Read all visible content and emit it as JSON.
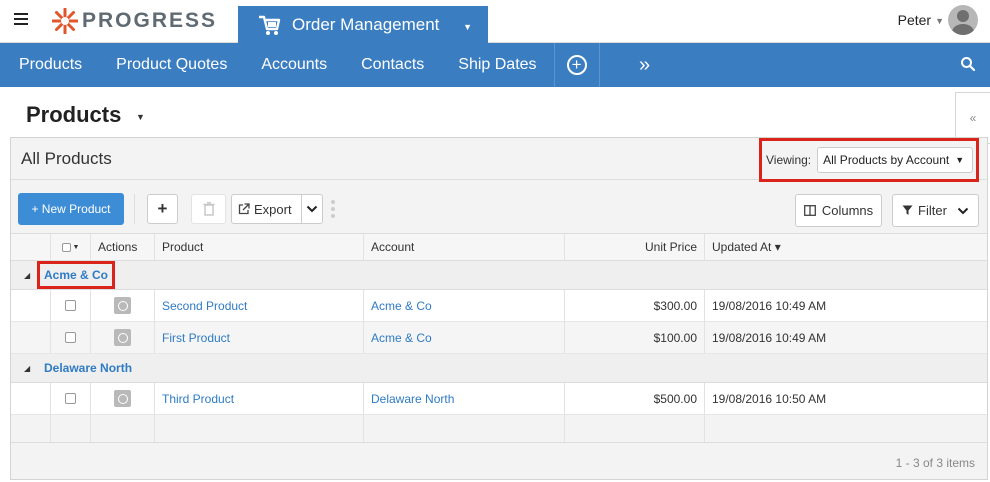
{
  "topbar": {
    "brand": "PROGRESS",
    "app_name": "Order Management",
    "user_name": "Peter"
  },
  "nav": {
    "items": [
      "Products",
      "Product Quotes",
      "Accounts",
      "Contacts",
      "Ship Dates"
    ]
  },
  "page": {
    "title": "Products"
  },
  "panel": {
    "view_title": "All Products",
    "viewing_label": "Viewing:",
    "viewing_value": "All Products by Account"
  },
  "toolbar": {
    "new_label": "+ New Product",
    "export_label": "Export",
    "columns_label": "Columns",
    "filter_label": "Filter"
  },
  "grid": {
    "headers": {
      "actions": "Actions",
      "product": "Product",
      "account": "Account",
      "unit_price": "Unit Price",
      "updated_at": "Updated At ▾"
    },
    "groups": [
      {
        "name": "Acme & Co",
        "rows": [
          {
            "product": "Second Product",
            "account": "Acme & Co",
            "unit_price": "$300.00",
            "updated_at": "19/08/2016 10:49 AM"
          },
          {
            "product": "First Product",
            "account": "Acme & Co",
            "unit_price": "$100.00",
            "updated_at": "19/08/2016 10:49 AM"
          }
        ]
      },
      {
        "name": "Delaware North",
        "rows": [
          {
            "product": "Third Product",
            "account": "Delaware North",
            "unit_price": "$500.00",
            "updated_at": "19/08/2016 10:50 AM"
          }
        ]
      }
    ],
    "footer_count": "1 - 3 of 3 items"
  },
  "colors": {
    "brand_blue": "#3a7dc0",
    "link_blue": "#2f7bc4",
    "highlight_red": "#d9231b",
    "logo_orange": "#e2542a"
  }
}
